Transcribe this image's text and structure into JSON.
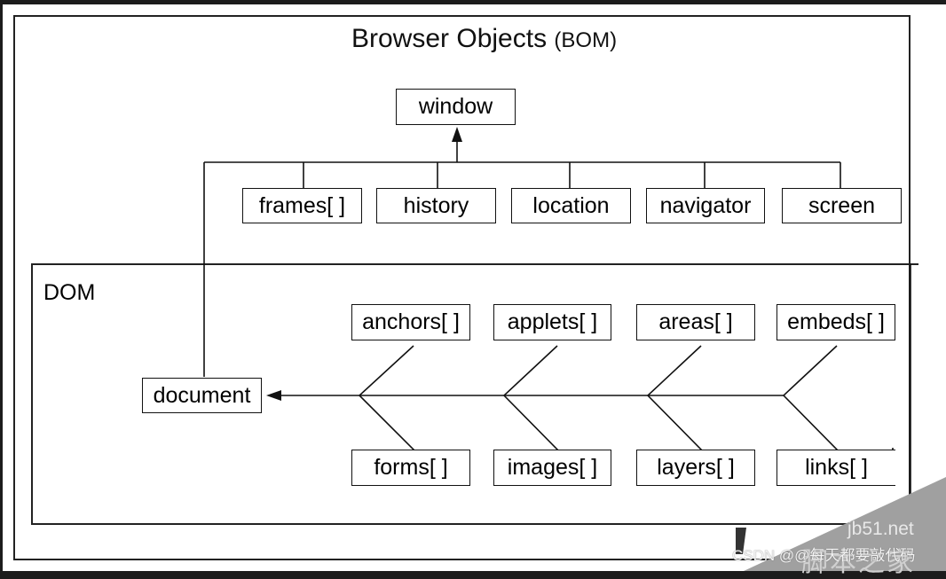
{
  "title": {
    "main": "Browser Objects",
    "abbr": "(BOM)"
  },
  "root": "window",
  "bom_children": [
    "frames[ ]",
    "history",
    "location",
    "navigator",
    "screen"
  ],
  "dom": {
    "label": "DOM",
    "document": "document",
    "top_row": [
      "anchors[ ]",
      "applets[ ]",
      "areas[ ]",
      "embeds[ ]"
    ],
    "bottom_row": [
      "forms[ ]",
      "images[ ]",
      "layers[ ]",
      "links[ ]"
    ]
  },
  "watermark": {
    "site": "jb51.net",
    "site_cn": "脚本之家",
    "credit": "CSDN @@每天都要敲代码"
  },
  "colors": {
    "line": "#111111",
    "background": "#ffffff",
    "page_frame": "#1c1c1c",
    "watermark_gray": "#a0a0a0"
  }
}
